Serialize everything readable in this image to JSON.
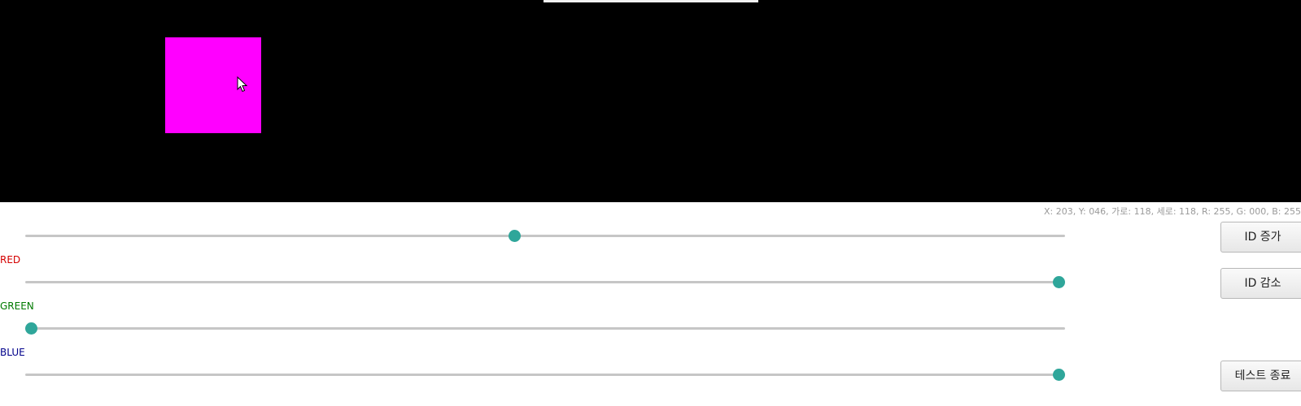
{
  "canvas": {
    "background_color": "#000000",
    "square_color": "#FF00FF"
  },
  "status_readout": "X: 203, Y: 046, 가로: 118, 세로: 118, R: 255, G: 000, B: 255",
  "sliders": [
    {
      "label": "",
      "label_color": "",
      "value": 0.47
    },
    {
      "label": "RED",
      "label_color": "#d40000",
      "value": 1.0
    },
    {
      "label": "GREEN",
      "label_color": "#007a00",
      "value": 0.0
    },
    {
      "label": "BLUE",
      "label_color": "#00008b",
      "value": 1.0
    }
  ],
  "buttons": {
    "id_increase": "ID 증가",
    "id_decrease": "ID 감소",
    "end_test": "테스트 종료"
  },
  "accent_color": "#2fa69a",
  "icons": {
    "cursor": "mouse-pointer-icon"
  }
}
